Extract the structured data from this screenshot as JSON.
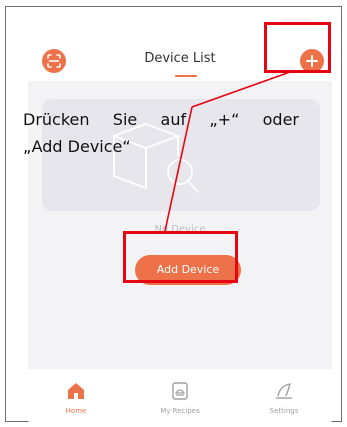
{
  "header": {
    "title": "Device List",
    "scan_icon": "scan-icon",
    "add_icon": "plus-icon"
  },
  "main": {
    "empty_text": "No Device",
    "add_button_label": "Add Device"
  },
  "tabbar": {
    "items": [
      {
        "label": "Home",
        "icon": "home-icon",
        "active": true
      },
      {
        "label": "My Recipes",
        "icon": "recipes-icon",
        "active": false
      },
      {
        "label": "Settings",
        "icon": "settings-icon",
        "active": false
      }
    ]
  },
  "annotation": {
    "line1": "Drücken Sie auf „+“ oder",
    "line2": "„Add Device“"
  },
  "colors": {
    "accent": "#ee7249",
    "highlight": "#e40613"
  }
}
